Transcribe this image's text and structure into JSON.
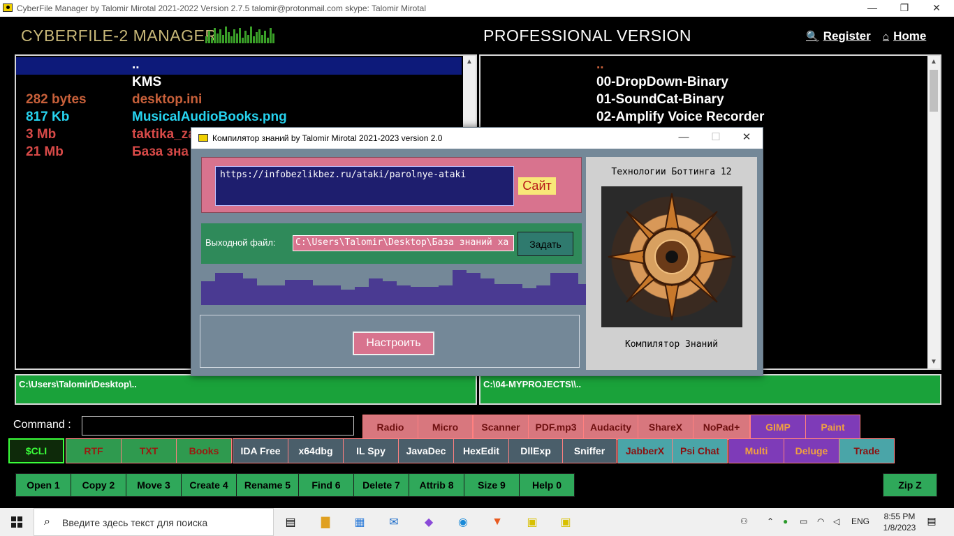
{
  "window": {
    "title": "CyberFile Manager by Talomir Mirotal 2021-2022 Version 2.7.5    talomir@protonmail.com    skype: Talomir Mirotal"
  },
  "header": {
    "brand": "CYBERFILE-2 MANAGER",
    "pro_title": "PROFESSIONAL VERSION",
    "register": "Register",
    "home": "Home"
  },
  "left_panel": {
    "rows": [
      {
        "size": "",
        "name": ".."
      },
      {
        "size": "",
        "name": "KMS"
      },
      {
        "size": "282  bytes",
        "name": "desktop.ini"
      },
      {
        "size": "817 Kb",
        "name": "MusicalAudioBooks.png"
      },
      {
        "size": "3 Mb",
        "name": "taktika_za"
      },
      {
        "size": "21 Mb",
        "name": "База зна"
      }
    ],
    "path": "C:\\Users\\Talomir\\Desktop\\.."
  },
  "right_panel": {
    "rows": [
      {
        "name": ".."
      },
      {
        "name": "00-DropDown-Binary"
      },
      {
        "name": "01-SoundCat-Binary"
      },
      {
        "name": "02-Amplify Voice Recorder"
      }
    ],
    "path": "C:\\04-MYPROJECTS\\\\.."
  },
  "command": {
    "label": "Command :",
    "value": ""
  },
  "buttons_row1": [
    "Radio",
    "Micro",
    "Scanner",
    "PDF.mp3",
    "Audacity",
    "ShareX",
    "NoPad+",
    "GIMP",
    "Paint"
  ],
  "buttons_row2": [
    "$CLI",
    "RTF",
    "TXT",
    "Books",
    "IDA Free",
    "x64dbg",
    "IL Spy",
    "JavaDec",
    "HexEdit",
    "DllExp",
    "Sniffer",
    "JabberX",
    "Psi Chat",
    "Multi",
    "Deluge",
    "Trade"
  ],
  "buttons_row3": [
    "Open 1",
    "Copy 2",
    "Move 3",
    "Create 4",
    "Rename 5",
    "Find 6",
    "Delete 7",
    "Attrib 8",
    "Size 9",
    "Help 0",
    "Zip Z"
  ],
  "dialog": {
    "title": "Компилятор знаний by Talomir Mirotal 2021-2023 version 2.0",
    "url": "https://infobezlikbez.ru/ataki/parolnye-ataki",
    "site_button": "Сайт",
    "output_label": "Выходной файл:",
    "output_value": "C:\\Users\\Talomir\\Desktop\\База знаний ха",
    "set_button": "Задать",
    "setup_button": "Настроить",
    "side_title": "Технологии Боттинга 12",
    "side_caption": "Компилятор Знаний"
  },
  "taskbar": {
    "search_placeholder": "Введите здесь текст для поиска",
    "lang": "ENG",
    "time": "8:55 PM",
    "date": "1/8/2023"
  },
  "colors": {
    "accent_green": "#1aa23a",
    "panel_selection": "#0d1a7a",
    "dialog_bg": "#748898"
  }
}
